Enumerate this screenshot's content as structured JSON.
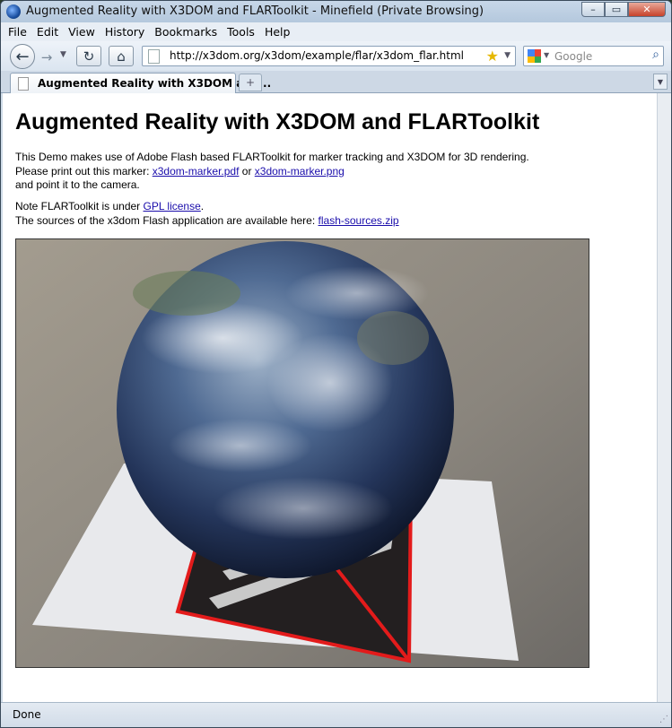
{
  "window": {
    "title": "Augmented Reality with X3DOM and FLARToolkit - Minefield (Private Browsing)",
    "controls": [
      "–",
      "▭",
      "✕"
    ]
  },
  "menu": [
    "File",
    "Edit",
    "View",
    "History",
    "Bookmarks",
    "Tools",
    "Help"
  ],
  "nav": {
    "back_icon": "←",
    "forward_icon": "→",
    "reload_icon": "↻",
    "home_icon": "⌂",
    "url": "http://x3dom.org/x3dom/example/flar/x3dom_flar.html",
    "search_placeholder": "Google"
  },
  "tab": {
    "label": "Augmented Reality with X3DOM and...",
    "new_tab_icon": "+"
  },
  "page": {
    "title": "Augmented Reality with X3DOM and FLARToolkit",
    "intro_line1": "This Demo makes use of Adobe Flash based FLARToolkit for marker tracking and X3DOM for 3D rendering.",
    "intro_line2_prefix": "Please print out this marker: ",
    "link_pdf": "x3dom-marker.pdf",
    "or_text": " or ",
    "link_png": "x3dom-marker.png",
    "intro_line3": "and point it to the camera.",
    "note_prefix": "Note FLARToolkit is under ",
    "link_gpl": "GPL license",
    "note_suffix": ".",
    "sources_prefix": "The sources of the x3dom Flash application are available here: ",
    "link_sources": "flash-sources.zip"
  },
  "status": {
    "text": "Done"
  }
}
